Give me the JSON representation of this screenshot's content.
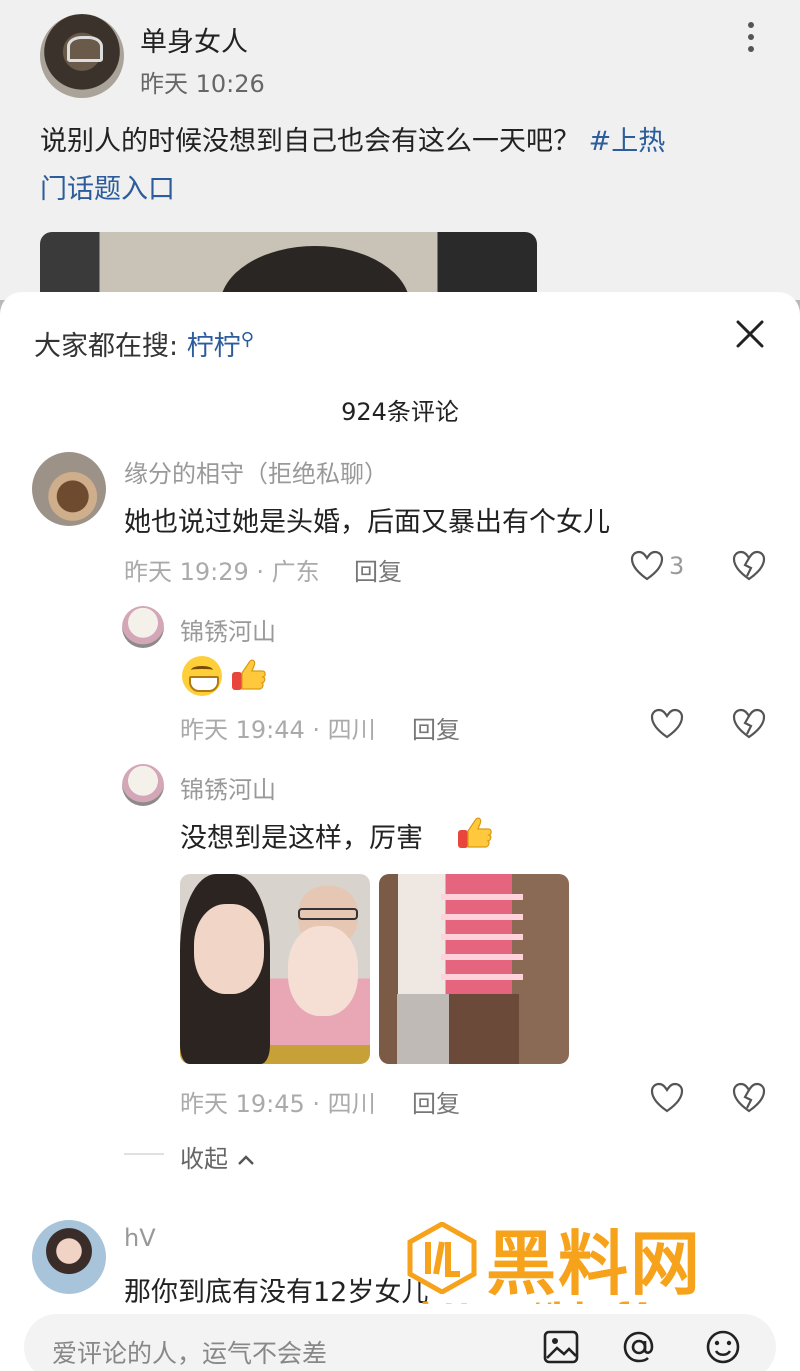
{
  "post": {
    "author": "单身女人",
    "time": "昨天 10:26",
    "text": "说别人的时候没想到自己也会有这么一天吧？",
    "hashtag_line1": "#上热",
    "hashtag_line2": "门话题入口"
  },
  "sheet": {
    "search_prefix": "大家都在搜: ",
    "search_keyword": "柠柠",
    "comment_count": "924条评论"
  },
  "comments": [
    {
      "name": "缘分的相守（拒绝私聊）",
      "text": "她也说过她是头婚，后面又暴出有个女儿",
      "meta": "昨天 19:29 · 广东",
      "reply_label": "回复",
      "likes": "3"
    }
  ],
  "replies": [
    {
      "name": "锦锈河山",
      "meta": "昨天 19:44 · 四川",
      "reply_label": "回复"
    },
    {
      "name": "锦锈河山",
      "text": "没想到是这样，厉害",
      "meta": "昨天 19:45 · 四川",
      "reply_label": "回复"
    }
  ],
  "collapse_label": "收起",
  "next_comment": {
    "name": "hV",
    "text": "那你到底有没有12岁女儿"
  },
  "input": {
    "placeholder": "爱评论的人，运气不会差"
  },
  "watermark": {
    "brand": "黑料网",
    "url": "https://hlwf4.com"
  },
  "colors": {
    "link": "#2c5c9c",
    "watermark": "#f7a21b"
  }
}
